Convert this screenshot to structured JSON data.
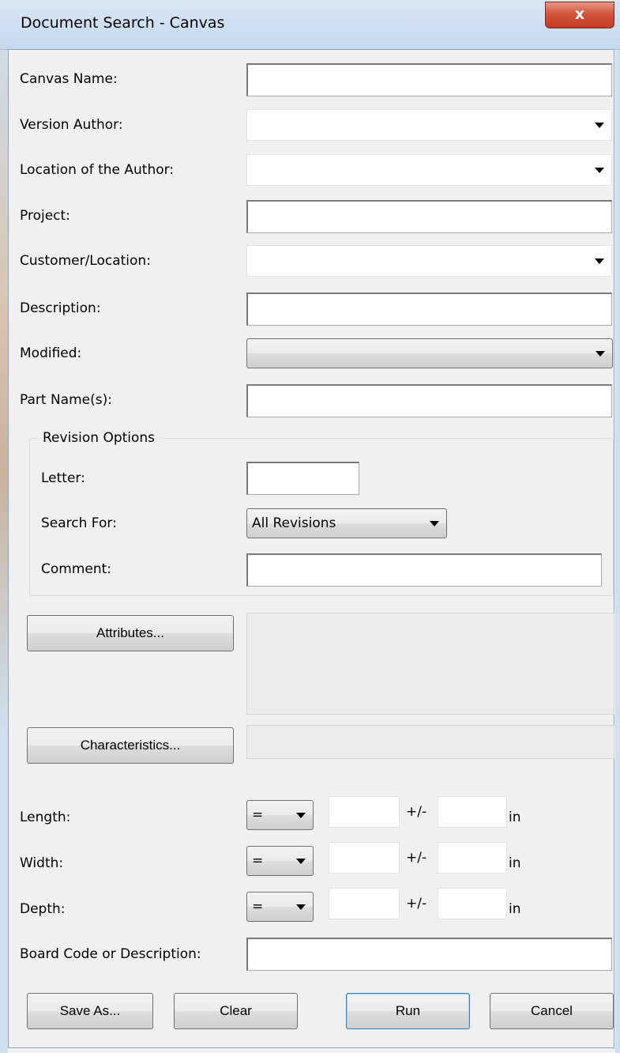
{
  "window": {
    "title": "Document Search - Canvas",
    "close_label": "x"
  },
  "fields": {
    "canvas_name": {
      "label": "Canvas Name:",
      "value": ""
    },
    "version_author": {
      "label": "Version Author:",
      "value": ""
    },
    "location_author": {
      "label": "Location of the Author:",
      "value": ""
    },
    "project": {
      "label": "Project:",
      "value": ""
    },
    "customer_location": {
      "label": "Customer/Location:",
      "value": ""
    },
    "description": {
      "label": "Description:",
      "value": ""
    },
    "modified": {
      "label": "Modified:",
      "value": ""
    },
    "part_names": {
      "label": "Part Name(s):",
      "value": ""
    }
  },
  "revision": {
    "group_title": "Revision Options",
    "letter_label": "Letter:",
    "letter_value": "",
    "search_for_label": "Search For:",
    "search_for_value": "All Revisions",
    "comment_label": "Comment:",
    "comment_value": ""
  },
  "buttons": {
    "attributes": "Attributes...",
    "characteristics": "Characteristics...",
    "save_as": "Save As...",
    "clear": "Clear",
    "run": "Run",
    "cancel": "Cancel"
  },
  "dimensions": {
    "operator": "=",
    "tolerance_sign": "+/-",
    "unit": "in",
    "rows": [
      {
        "label": "Length:",
        "value": "",
        "tolerance": ""
      },
      {
        "label": "Width:",
        "value": "",
        "tolerance": ""
      },
      {
        "label": "Depth:",
        "value": "",
        "tolerance": ""
      }
    ]
  },
  "board_code": {
    "label": "Board Code or Description:",
    "value": ""
  }
}
